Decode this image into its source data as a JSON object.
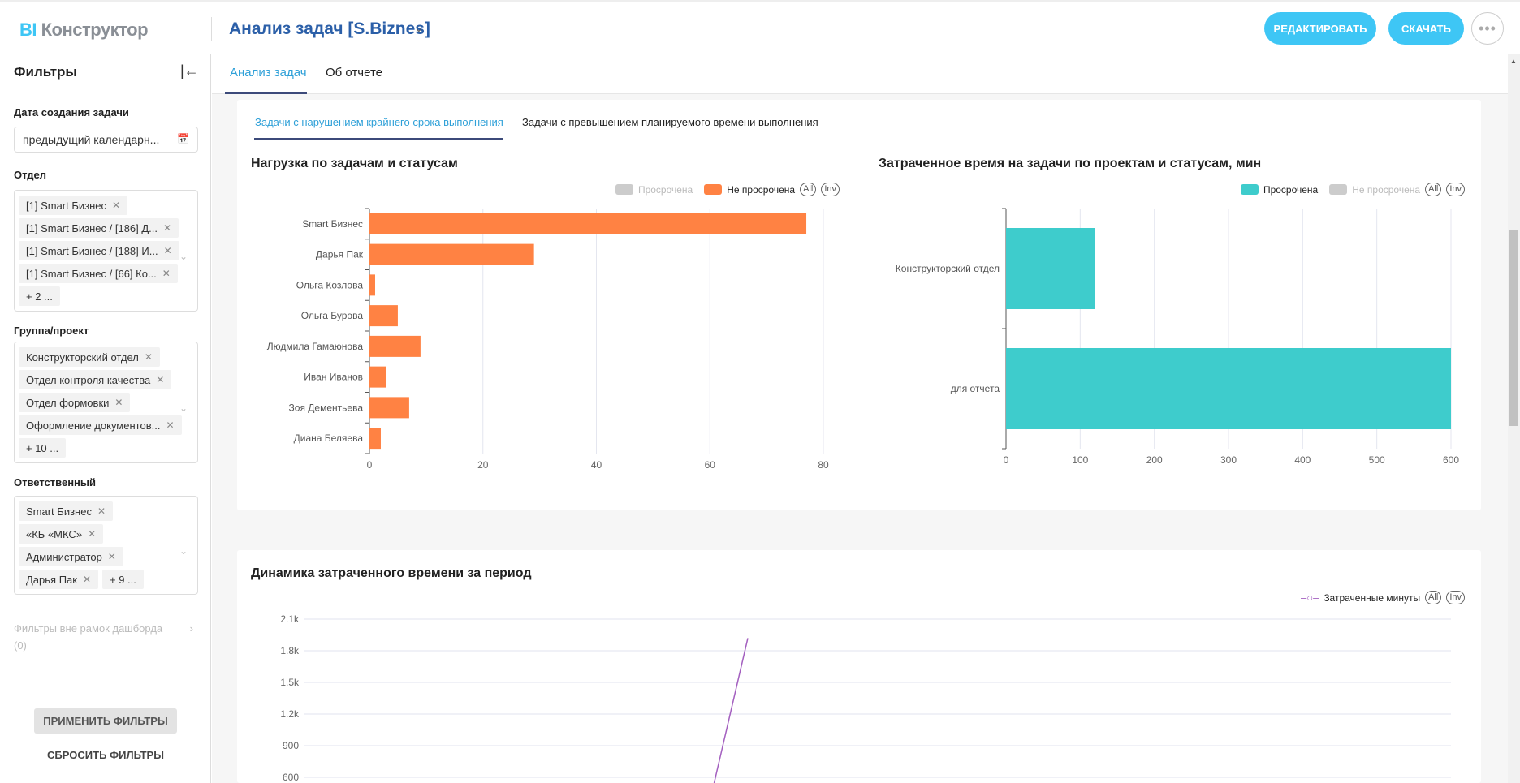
{
  "header": {
    "logo_bi": "BI",
    "logo_text": "Конструктор",
    "report_title": "Анализ задач [S.Biznes]",
    "edit_label": "РЕДАКТИРОВАТЬ",
    "download_label": "СКАЧАТЬ",
    "more_label": "•••"
  },
  "sidebar": {
    "title": "Фильтры",
    "date": {
      "label": "Дата создания задачи",
      "value": "предыдущий календарн..."
    },
    "department": {
      "label": "Отдел",
      "chips": [
        "[1] Smart Бизнес",
        "[1] Smart Бизнес / [186] Д...",
        "[1] Smart Бизнес / [188] И...",
        "[1] Smart Бизнес / [66] Ко..."
      ],
      "more": "+ 2 ..."
    },
    "group": {
      "label": "Группа/проект",
      "chips": [
        "Конструкторский отдел",
        "Отдел контроля качества",
        "Отдел формовки",
        "Оформление документов..."
      ],
      "more": "+ 10 ..."
    },
    "responsible": {
      "label": "Ответственный",
      "chips": [
        "Smart Бизнес",
        "«КБ «МКС»",
        "Администратор",
        "Дарья Пак"
      ],
      "more": "+ 9 ..."
    },
    "outside_filters": "Фильтры вне рамок дашборда",
    "outside_count": "(0)",
    "apply_label": "ПРИМЕНИТЬ ФИЛЬТРЫ",
    "reset_label": "СБРОСИТЬ ФИЛЬТРЫ"
  },
  "main": {
    "tabs": [
      "Анализ задач",
      "Об отчете"
    ],
    "subtabs": [
      "Задачи с нарушением крайнего срока выполнения",
      "Задачи с превышением планируемого времени выполнения"
    ]
  },
  "legend_common": {
    "all": "All",
    "inv": "Inv"
  },
  "colors": {
    "accent": "#3ec6f5",
    "orange": "#ff8243",
    "teal": "#3ecccc",
    "purple": "#a35fbf",
    "inactive": "#cccccc"
  },
  "chart_data": [
    {
      "type": "bar",
      "orientation": "horizontal",
      "title": "Нагрузка по задачам и статусам",
      "legend": [
        "Просрочена",
        "Не просрочена"
      ],
      "legend_active": [
        false,
        true
      ],
      "categories": [
        "Smart Бизнес",
        "Дарья Пак",
        "Ольга Козлова",
        "Ольга Бурова",
        "Людмила Гамаюнова",
        "Иван Иванов",
        "Зоя Дементьева",
        "Диана Беляева"
      ],
      "series": [
        {
          "name": "Не просрочена",
          "values": [
            77,
            29,
            1,
            5,
            9,
            3,
            7,
            2
          ]
        }
      ],
      "xlim": [
        0,
        80
      ],
      "xticks": [
        "0",
        "20",
        "40",
        "60",
        "80"
      ]
    },
    {
      "type": "bar",
      "orientation": "horizontal",
      "title": "Затраченное время на задачи по проектам и статусам, мин",
      "legend": [
        "Просрочена",
        "Не просрочена"
      ],
      "legend_active": [
        true,
        false
      ],
      "categories": [
        "Конструкторский отдел",
        "для отчета"
      ],
      "series": [
        {
          "name": "Просрочена",
          "values": [
            120,
            600
          ]
        }
      ],
      "xlim": [
        0,
        600
      ],
      "xticks": [
        "0",
        "100",
        "200",
        "300",
        "400",
        "500",
        "600"
      ]
    },
    {
      "type": "line",
      "title": "Динамика затраченного времени за период",
      "legend": [
        "Затраченные минуты"
      ],
      "yticks": [
        "2.1k",
        "1.8k",
        "1.5k",
        "1.2k",
        "900",
        "600"
      ],
      "ylim": [
        600,
        2100
      ],
      "series": [
        {
          "name": "Затраченные минуты",
          "values": [
            0,
            1920
          ]
        }
      ]
    }
  ]
}
